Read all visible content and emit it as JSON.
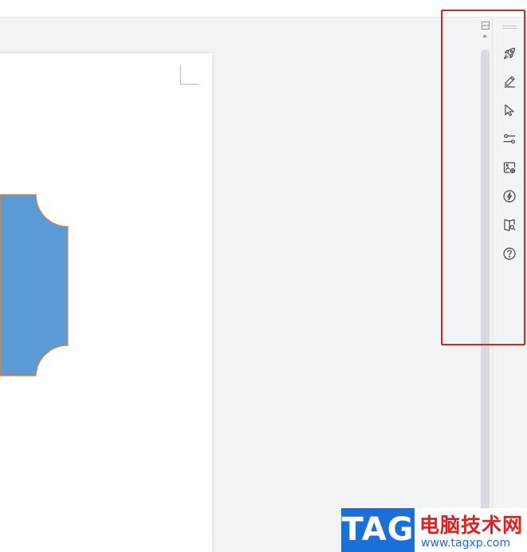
{
  "colors": {
    "shape_fill": "#5b9bd5",
    "shape_outline": "#ed7d31",
    "highlight": "#e02020",
    "icon": "#44474d"
  },
  "side_toolbar": {
    "items": [
      {
        "name": "rocket-icon"
      },
      {
        "name": "pen-icon"
      },
      {
        "name": "cursor-icon"
      },
      {
        "name": "sliders-icon"
      },
      {
        "name": "image-ai-icon"
      },
      {
        "name": "lightning-icon"
      },
      {
        "name": "book-search-icon"
      },
      {
        "name": "help-icon"
      }
    ]
  },
  "watermark": {
    "tag": "TAG",
    "title": "电脑技术网",
    "url": "www.tagxp.com"
  }
}
